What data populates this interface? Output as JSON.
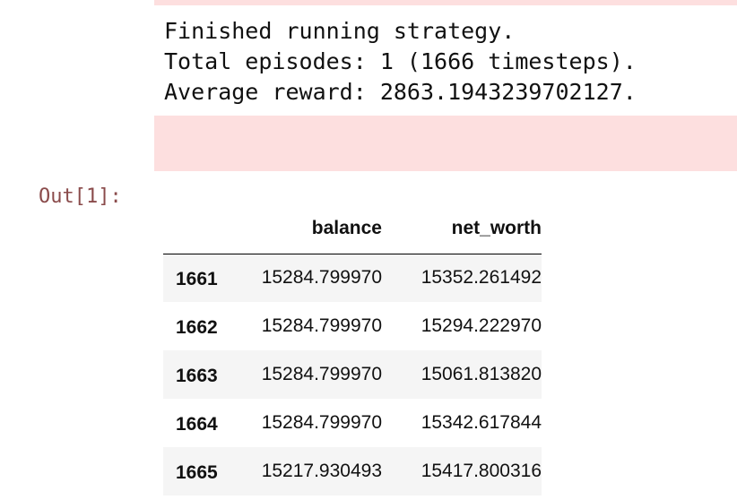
{
  "stderr": {
    "lines": [
      "Finished running strategy.",
      "Total episodes: 1 (1666 timesteps).",
      "Average reward: 2863.1943239702127."
    ]
  },
  "output": {
    "prompt": "Out[1]:"
  },
  "dataframe": {
    "columns": [
      "balance",
      "net_worth"
    ],
    "rows": [
      {
        "index": "1661",
        "balance": "15284.799970",
        "net_worth": "15352.261492"
      },
      {
        "index": "1662",
        "balance": "15284.799970",
        "net_worth": "15294.222970"
      },
      {
        "index": "1663",
        "balance": "15284.799970",
        "net_worth": "15061.813820"
      },
      {
        "index": "1664",
        "balance": "15284.799970",
        "net_worth": "15342.617844"
      },
      {
        "index": "1665",
        "balance": "15217.930493",
        "net_worth": "15417.800316"
      }
    ]
  }
}
